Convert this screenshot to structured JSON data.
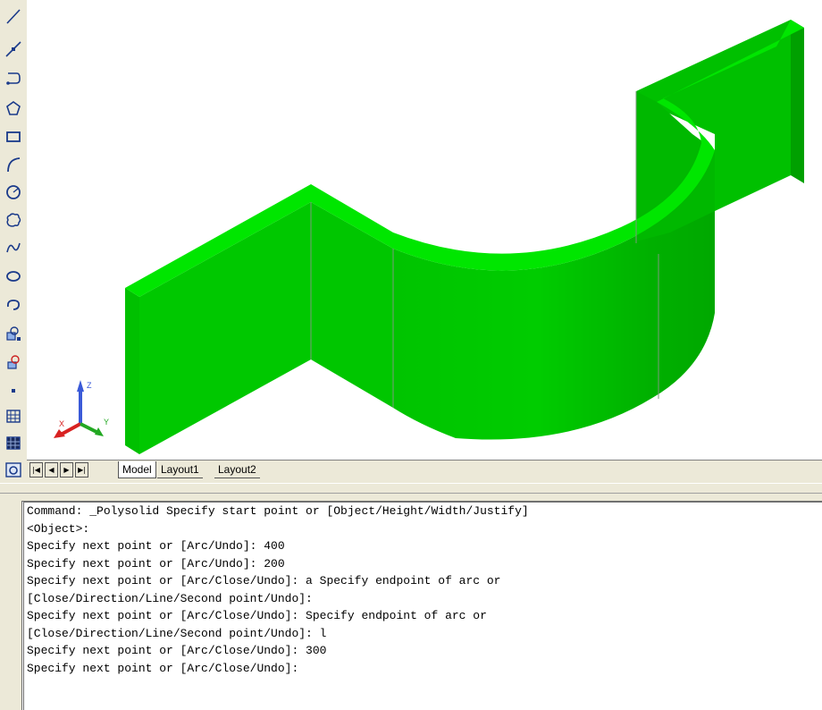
{
  "toolbar": {
    "tools": [
      {
        "name": "line-icon"
      },
      {
        "name": "construction-line-icon"
      },
      {
        "name": "polyline-icon"
      },
      {
        "name": "polygon-icon"
      },
      {
        "name": "rectangle-icon"
      },
      {
        "name": "arc-icon"
      },
      {
        "name": "circle-icon"
      },
      {
        "name": "revision-cloud-icon"
      },
      {
        "name": "spline-icon"
      },
      {
        "name": "ellipse-icon"
      },
      {
        "name": "ellipse-arc-icon"
      },
      {
        "name": "insert-block-icon"
      },
      {
        "name": "make-block-icon"
      },
      {
        "name": "point-icon"
      },
      {
        "name": "hatch-icon"
      },
      {
        "name": "gradient-icon"
      },
      {
        "name": "region-icon"
      }
    ]
  },
  "viewport": {
    "solid_color": "#00cc00",
    "top_color": "#00e800",
    "ucs": {
      "z": "Z",
      "y": "Y",
      "x": "X"
    }
  },
  "tabs": {
    "items": [
      "Model",
      "Layout1",
      "Layout2"
    ],
    "active": "Model"
  },
  "command": {
    "lines": [
      "Command: _Polysolid Specify start point or [Object/Height/Width/Justify]",
      "<Object>:",
      "Specify next point or [Arc/Undo]: 400",
      "Specify next point or [Arc/Undo]: 200",
      "Specify next point or [Arc/Close/Undo]: a Specify endpoint of arc or",
      "[Close/Direction/Line/Second point/Undo]:",
      "Specify next point or [Arc/Close/Undo]: Specify endpoint of arc or",
      "[Close/Direction/Line/Second point/Undo]: l",
      "Specify next point or [Arc/Close/Undo]: 300",
      "Specify next point or [Arc/Close/Undo]:"
    ]
  }
}
